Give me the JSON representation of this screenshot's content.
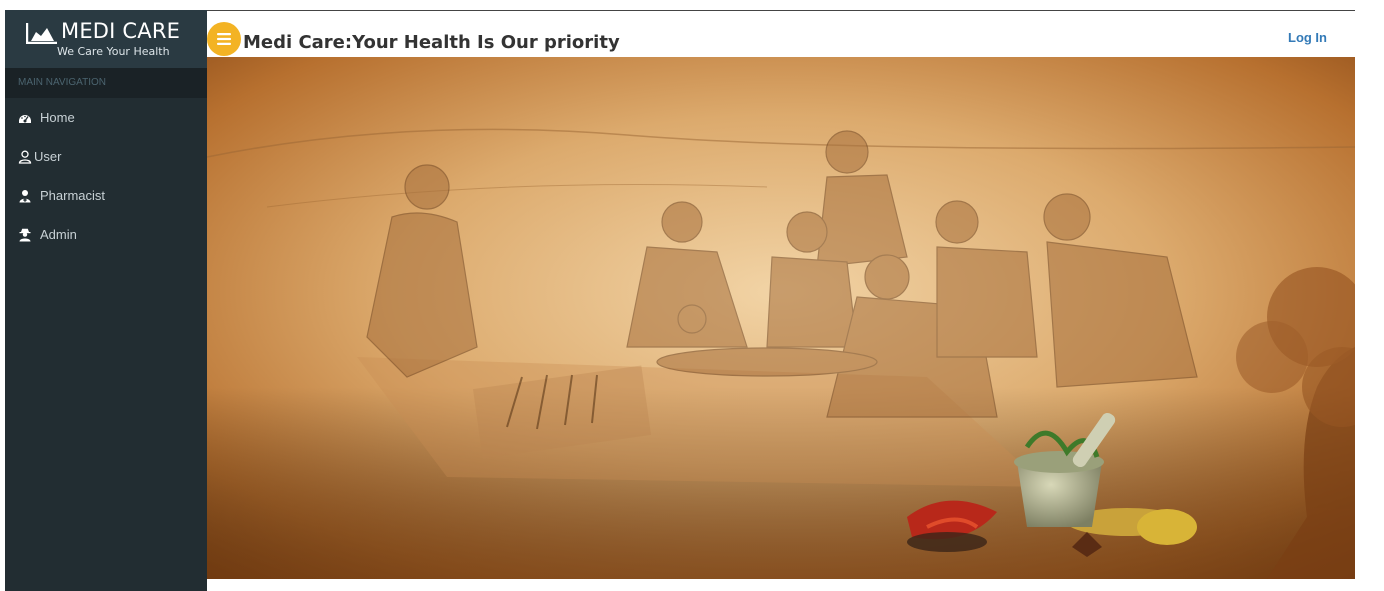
{
  "brand": {
    "title": "MEDI CARE",
    "tagline": "We Care Your Health",
    "icon": "area-chart-icon"
  },
  "sidebar": {
    "section_header": "MAIN NAVIGATION",
    "items": [
      {
        "label": "Home",
        "icon": "dashboard-icon"
      },
      {
        "label": "User",
        "icon": "user-icon"
      },
      {
        "label": "Pharmacist",
        "icon": "user-md-icon"
      },
      {
        "label": "Admin",
        "icon": "user-secret-icon"
      }
    ]
  },
  "header": {
    "menu_icon": "hamburger-menu-icon",
    "title": "Medi Care:Your Health Is Our priority",
    "login_label": "Log In"
  },
  "banner": {
    "description_icon": "ayurveda-banner-image"
  },
  "colors": {
    "sidebar_bg": "#222d32",
    "brand_bg": "#2a3a42",
    "nav_header_bg": "#1a2226",
    "accent_yellow": "#f3b324",
    "link_blue": "#337ab7"
  }
}
